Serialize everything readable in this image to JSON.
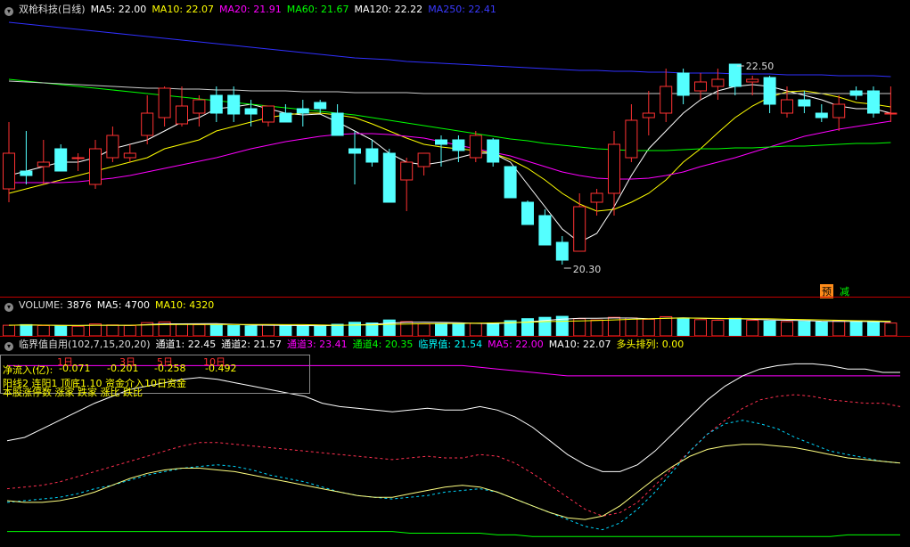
{
  "header": {
    "name": "双枪科技(日线)",
    "ma_items": [
      {
        "text": "MA5: 22.00",
        "color": "#ffffff"
      },
      {
        "text": "MA10: 22.07",
        "color": "#ffff00"
      },
      {
        "text": "MA20: 21.91",
        "color": "#ff00ff"
      },
      {
        "text": "MA60: 21.67",
        "color": "#00ff00"
      },
      {
        "text": "MA120: 22.22",
        "color": "#ffffff"
      },
      {
        "text": "MA250: 22.41",
        "color": "#3a3aff"
      }
    ]
  },
  "badges": {
    "a": "预",
    "b": "减"
  },
  "volume_header": {
    "label": "VOLUME:",
    "items": [
      {
        "text": "3876",
        "color": "#ffffff"
      },
      {
        "text": "MA5: 4700",
        "color": "#ffffff"
      },
      {
        "text": "MA10: 4320",
        "color": "#ffff00"
      }
    ]
  },
  "indicator_header": {
    "label": "临界值自用(102,7,15,20,20)",
    "items": [
      {
        "text": "通道1: 22.45",
        "color": "#ffffff"
      },
      {
        "text": "通道2: 21.57",
        "color": "#ffffff"
      },
      {
        "text": "通道3: 23.41",
        "color": "#ff00ff"
      },
      {
        "text": "通道4: 20.35",
        "color": "#00ff00"
      },
      {
        "text": "临界值: 21.54",
        "color": "#00ffff"
      },
      {
        "text": "MA5: 22.00",
        "color": "#ff00ff"
      },
      {
        "text": "MA10: 22.07",
        "color": "#ffffff"
      },
      {
        "text": "多头排列: 0.00",
        "color": "#ffff00"
      }
    ]
  },
  "info_box": {
    "row1": [
      "1日",
      "3日",
      "5日",
      "10日"
    ],
    "row2_label": "净流入(亿):",
    "row2": [
      "-0.071",
      "-0.201",
      "-0.258",
      "-0.492"
    ],
    "row3": "阳线2  连阳1  顶底1.10  资金介入10日资金",
    "row4": "本股涨停数  涨家  跌家  涨比  跌比"
  },
  "chart_data": {
    "type": "candlestick",
    "annotations": {
      "high": "22.50",
      "low": "20.30"
    },
    "candles": [
      {
        "o": 21.15,
        "h": 21.9,
        "l": 21.0,
        "c": 21.55
      },
      {
        "o": 21.35,
        "h": 21.8,
        "l": 21.2,
        "c": 21.3
      },
      {
        "o": 21.4,
        "h": 21.7,
        "l": 21.2,
        "c": 21.45
      },
      {
        "o": 21.6,
        "h": 21.65,
        "l": 21.35,
        "c": 21.35
      },
      {
        "o": 21.5,
        "h": 21.55,
        "l": 21.35,
        "c": 21.5
      },
      {
        "o": 21.2,
        "h": 21.7,
        "l": 21.15,
        "c": 21.6
      },
      {
        "o": 21.5,
        "h": 21.85,
        "l": 21.45,
        "c": 21.75
      },
      {
        "o": 21.5,
        "h": 21.65,
        "l": 21.45,
        "c": 21.55
      },
      {
        "o": 21.75,
        "h": 22.2,
        "l": 21.65,
        "c": 22.0
      },
      {
        "o": 21.95,
        "h": 22.3,
        "l": 21.85,
        "c": 22.28
      },
      {
        "o": 21.88,
        "h": 22.3,
        "l": 21.85,
        "c": 22.08
      },
      {
        "o": 22.0,
        "h": 22.2,
        "l": 21.85,
        "c": 22.15
      },
      {
        "o": 22.2,
        "h": 22.3,
        "l": 21.9,
        "c": 22.0
      },
      {
        "o": 22.2,
        "h": 22.3,
        "l": 21.9,
        "c": 21.99
      },
      {
        "o": 22.05,
        "h": 22.15,
        "l": 21.85,
        "c": 21.99
      },
      {
        "o": 21.9,
        "h": 22.05,
        "l": 21.85,
        "c": 22.08
      },
      {
        "o": 22.0,
        "h": 22.1,
        "l": 21.9,
        "c": 21.9
      },
      {
        "o": 22.05,
        "h": 22.15,
        "l": 21.85,
        "c": 22.0
      },
      {
        "o": 22.12,
        "h": 22.15,
        "l": 22.0,
        "c": 22.05
      },
      {
        "o": 22.0,
        "h": 22.1,
        "l": 21.8,
        "c": 21.75
      },
      {
        "o": 21.6,
        "h": 21.8,
        "l": 21.2,
        "c": 21.55
      },
      {
        "o": 21.6,
        "h": 21.7,
        "l": 21.4,
        "c": 21.45
      },
      {
        "o": 21.55,
        "h": 21.6,
        "l": 21.0,
        "c": 21.0
      },
      {
        "o": 21.25,
        "h": 21.5,
        "l": 20.9,
        "c": 21.45
      },
      {
        "o": 21.4,
        "h": 21.55,
        "l": 21.3,
        "c": 21.55
      },
      {
        "o": 21.7,
        "h": 21.75,
        "l": 21.4,
        "c": 21.65
      },
      {
        "o": 21.7,
        "h": 21.75,
        "l": 21.45,
        "c": 21.58
      },
      {
        "o": 21.5,
        "h": 21.8,
        "l": 21.45,
        "c": 21.75
      },
      {
        "o": 21.7,
        "h": 21.72,
        "l": 21.4,
        "c": 21.45
      },
      {
        "o": 21.4,
        "h": 21.4,
        "l": 21.05,
        "c": 21.05
      },
      {
        "o": 21.0,
        "h": 21.02,
        "l": 20.75,
        "c": 20.75
      },
      {
        "o": 20.85,
        "h": 20.92,
        "l": 20.52,
        "c": 20.52
      },
      {
        "o": 20.55,
        "h": 20.62,
        "l": 20.3,
        "c": 20.35
      },
      {
        "o": 20.45,
        "h": 21.1,
        "l": 20.45,
        "c": 20.95
      },
      {
        "o": 21.0,
        "h": 21.15,
        "l": 20.85,
        "c": 21.1
      },
      {
        "o": 21.1,
        "h": 21.8,
        "l": 20.85,
        "c": 21.65
      },
      {
        "o": 21.5,
        "h": 22.1,
        "l": 21.45,
        "c": 21.92
      },
      {
        "o": 21.95,
        "h": 22.25,
        "l": 21.75,
        "c": 22.0
      },
      {
        "o": 22.0,
        "h": 22.5,
        "l": 21.9,
        "c": 22.3
      },
      {
        "o": 22.45,
        "h": 22.5,
        "l": 22.1,
        "c": 22.2
      },
      {
        "o": 22.25,
        "h": 22.45,
        "l": 22.15,
        "c": 22.35
      },
      {
        "o": 22.3,
        "h": 22.5,
        "l": 22.15,
        "c": 22.38
      },
      {
        "o": 22.55,
        "h": 22.55,
        "l": 22.2,
        "c": 22.3
      },
      {
        "o": 22.35,
        "h": 22.42,
        "l": 22.2,
        "c": 22.38
      },
      {
        "o": 22.4,
        "h": 22.42,
        "l": 22.0,
        "c": 22.1
      },
      {
        "o": 22.0,
        "h": 22.3,
        "l": 21.95,
        "c": 22.15
      },
      {
        "o": 22.15,
        "h": 22.25,
        "l": 22.0,
        "c": 22.08
      },
      {
        "o": 22.0,
        "h": 22.1,
        "l": 21.9,
        "c": 21.95
      },
      {
        "o": 21.95,
        "h": 22.2,
        "l": 21.8,
        "c": 22.1
      },
      {
        "o": 22.25,
        "h": 22.3,
        "l": 22.15,
        "c": 22.2
      },
      {
        "o": 22.25,
        "h": 22.3,
        "l": 21.95,
        "c": 22.0
      },
      {
        "o": 22.0,
        "h": 22.3,
        "l": 21.9,
        "c": 22.0
      }
    ],
    "ma_lines": [
      {
        "name": "MA5",
        "color": "#ffffff",
        "values": [
          21.3,
          21.35,
          21.4,
          21.45,
          21.45,
          21.5,
          21.6,
          21.65,
          21.7,
          21.8,
          21.9,
          21.95,
          22.05,
          22.07,
          22.1,
          22.05,
          22.0,
          21.98,
          21.99,
          21.9,
          21.8,
          21.7,
          21.55,
          21.45,
          21.42,
          21.45,
          21.5,
          21.55,
          21.55,
          21.45,
          21.2,
          20.95,
          20.7,
          20.55,
          20.65,
          20.95,
          21.3,
          21.6,
          21.8,
          22.0,
          22.15,
          22.25,
          22.3,
          22.32,
          22.3,
          22.25,
          22.2,
          22.15,
          22.08,
          22.05,
          22.05,
          22.0
        ]
      },
      {
        "name": "MA10",
        "color": "#ffff00",
        "values": [
          21.1,
          21.15,
          21.2,
          21.25,
          21.3,
          21.35,
          21.4,
          21.45,
          21.5,
          21.6,
          21.65,
          21.7,
          21.8,
          21.85,
          21.9,
          21.95,
          21.98,
          22.0,
          22.0,
          21.98,
          21.95,
          21.88,
          21.8,
          21.72,
          21.65,
          21.62,
          21.6,
          21.58,
          21.55,
          21.48,
          21.38,
          21.25,
          21.1,
          20.98,
          20.9,
          20.92,
          21.0,
          21.1,
          21.25,
          21.45,
          21.6,
          21.78,
          21.95,
          22.08,
          22.18,
          22.24,
          22.25,
          22.22,
          22.18,
          22.12,
          22.1,
          22.07
        ]
      },
      {
        "name": "MA20",
        "color": "#ff00ff",
        "values": [
          21.22,
          21.22,
          21.22,
          21.22,
          21.23,
          21.25,
          21.27,
          21.3,
          21.34,
          21.38,
          21.42,
          21.46,
          21.5,
          21.55,
          21.6,
          21.64,
          21.68,
          21.71,
          21.74,
          21.76,
          21.77,
          21.77,
          21.76,
          21.74,
          21.72,
          21.68,
          21.64,
          21.6,
          21.56,
          21.52,
          21.46,
          21.4,
          21.34,
          21.3,
          21.27,
          21.26,
          21.26,
          21.27,
          21.3,
          21.34,
          21.4,
          21.45,
          21.5,
          21.56,
          21.62,
          21.68,
          21.74,
          21.78,
          21.82,
          21.85,
          21.88,
          21.91
        ]
      },
      {
        "name": "MA60",
        "color": "#00ff00",
        "values": [
          22.38,
          22.36,
          22.34,
          22.32,
          22.3,
          22.28,
          22.26,
          22.24,
          22.22,
          22.2,
          22.18,
          22.16,
          22.14,
          22.12,
          22.1,
          22.08,
          22.06,
          22.04,
          22.02,
          22.0,
          21.98,
          21.95,
          21.92,
          21.89,
          21.86,
          21.83,
          21.8,
          21.77,
          21.74,
          21.71,
          21.69,
          21.66,
          21.64,
          21.62,
          21.6,
          21.59,
          21.58,
          21.58,
          21.58,
          21.59,
          21.6,
          21.6,
          21.61,
          21.61,
          21.62,
          21.63,
          21.63,
          21.64,
          21.65,
          21.66,
          21.66,
          21.67
        ]
      },
      {
        "name": "MA120",
        "color": "#cccccc",
        "values": [
          22.36,
          22.35,
          22.34,
          22.33,
          22.32,
          22.31,
          22.3,
          22.29,
          22.28,
          22.28,
          22.27,
          22.27,
          22.26,
          22.26,
          22.25,
          22.25,
          22.25,
          22.24,
          22.24,
          22.24,
          22.23,
          22.23,
          22.23,
          22.23,
          22.22,
          22.22,
          22.22,
          22.22,
          22.22,
          22.22,
          22.22,
          22.22,
          22.22,
          22.22,
          22.22,
          22.22,
          22.22,
          22.22,
          22.22,
          22.22,
          22.22,
          22.22,
          22.22,
          22.22,
          22.22,
          22.22,
          22.22,
          22.22,
          22.22,
          22.22,
          22.22,
          22.22
        ]
      },
      {
        "name": "MA250",
        "color": "#3030ff",
        "values": [
          23.02,
          23.0,
          22.98,
          22.96,
          22.94,
          22.92,
          22.9,
          22.88,
          22.86,
          22.84,
          22.82,
          22.8,
          22.78,
          22.76,
          22.74,
          22.72,
          22.7,
          22.68,
          22.66,
          22.64,
          22.62,
          22.61,
          22.6,
          22.58,
          22.57,
          22.56,
          22.55,
          22.54,
          22.53,
          22.52,
          22.51,
          22.5,
          22.49,
          22.48,
          22.48,
          22.47,
          22.47,
          22.46,
          22.46,
          22.45,
          22.45,
          22.45,
          22.44,
          22.44,
          22.44,
          22.43,
          22.43,
          22.43,
          22.42,
          22.42,
          22.42,
          22.41
        ]
      }
    ],
    "volume": [
      3200,
      3400,
      3100,
      3000,
      2900,
      3600,
      3300,
      3100,
      4000,
      4200,
      3600,
      3400,
      3200,
      3100,
      3000,
      3300,
      3100,
      3000,
      2900,
      3500,
      4100,
      3900,
      4800,
      4300,
      3600,
      3700,
      3500,
      3800,
      3900,
      4600,
      5200,
      5600,
      5900,
      5200,
      4800,
      5600,
      5400,
      5000,
      5800,
      5400,
      4900,
      4700,
      5300,
      4700,
      4500,
      4300,
      4400,
      4200,
      4600,
      4300,
      4100,
      3876
    ],
    "indicator": {
      "ch1": [
        0.48,
        0.5,
        0.55,
        0.6,
        0.65,
        0.7,
        0.74,
        0.78,
        0.8,
        0.82,
        0.84,
        0.85,
        0.84,
        0.82,
        0.8,
        0.78,
        0.76,
        0.74,
        0.7,
        0.68,
        0.67,
        0.66,
        0.65,
        0.66,
        0.67,
        0.66,
        0.66,
        0.68,
        0.66,
        0.62,
        0.56,
        0.48,
        0.4,
        0.34,
        0.3,
        0.3,
        0.34,
        0.42,
        0.52,
        0.62,
        0.72,
        0.8,
        0.86,
        0.9,
        0.92,
        0.93,
        0.93,
        0.92,
        0.9,
        0.9,
        0.88,
        0.88
      ],
      "ch2": [
        0.2,
        0.21,
        0.22,
        0.24,
        0.27,
        0.3,
        0.33,
        0.36,
        0.39,
        0.42,
        0.45,
        0.47,
        0.47,
        0.46,
        0.45,
        0.44,
        0.43,
        0.42,
        0.41,
        0.4,
        0.39,
        0.38,
        0.37,
        0.38,
        0.39,
        0.38,
        0.38,
        0.4,
        0.39,
        0.35,
        0.29,
        0.22,
        0.15,
        0.08,
        0.04,
        0.06,
        0.12,
        0.22,
        0.32,
        0.42,
        0.52,
        0.6,
        0.67,
        0.72,
        0.74,
        0.75,
        0.74,
        0.72,
        0.71,
        0.7,
        0.7,
        0.68
      ],
      "ch3": [
        0.13,
        0.12,
        0.12,
        0.13,
        0.15,
        0.18,
        0.22,
        0.26,
        0.29,
        0.31,
        0.32,
        0.32,
        0.31,
        0.3,
        0.28,
        0.26,
        0.24,
        0.22,
        0.2,
        0.18,
        0.16,
        0.15,
        0.15,
        0.17,
        0.19,
        0.21,
        0.22,
        0.21,
        0.18,
        0.14,
        0.1,
        0.06,
        0.03,
        0.02,
        0.04,
        0.1,
        0.18,
        0.26,
        0.33,
        0.39,
        0.43,
        0.45,
        0.46,
        0.46,
        0.45,
        0.44,
        0.42,
        0.4,
        0.38,
        0.37,
        0.36,
        0.35
      ],
      "ch4": [
        0.12,
        0.13,
        0.14,
        0.15,
        0.17,
        0.2,
        0.22,
        0.25,
        0.28,
        0.3,
        0.32,
        0.33,
        0.34,
        0.33,
        0.31,
        0.28,
        0.26,
        0.24,
        0.21,
        0.18,
        0.16,
        0.15,
        0.14,
        0.15,
        0.16,
        0.18,
        0.19,
        0.2,
        0.18,
        0.14,
        0.1,
        0.06,
        0.02,
        -0.02,
        -0.04,
        0.0,
        0.08,
        0.18,
        0.3,
        0.42,
        0.52,
        0.58,
        0.6,
        0.58,
        0.55,
        0.5,
        0.46,
        0.42,
        0.4,
        0.38,
        0.36,
        0.35
      ],
      "ma5": [
        0.92,
        0.92,
        0.92,
        0.92,
        0.92,
        0.92,
        0.92,
        0.92,
        0.92,
        0.92,
        0.92,
        0.92,
        0.92,
        0.92,
        0.92,
        0.92,
        0.92,
        0.92,
        0.92,
        0.92,
        0.92,
        0.92,
        0.92,
        0.92,
        0.92,
        0.92,
        0.92,
        0.91,
        0.9,
        0.89,
        0.88,
        0.87,
        0.86,
        0.86,
        0.86,
        0.86,
        0.86,
        0.86,
        0.86,
        0.86,
        0.86,
        0.86,
        0.86,
        0.86,
        0.86,
        0.86,
        0.86,
        0.86,
        0.86,
        0.86,
        0.86,
        0.86
      ],
      "ch5": [
        -0.05,
        -0.05,
        -0.05,
        -0.05,
        -0.05,
        -0.05,
        -0.05,
        -0.05,
        -0.05,
        -0.05,
        -0.05,
        -0.05,
        -0.05,
        -0.05,
        -0.05,
        -0.05,
        -0.05,
        -0.05,
        -0.05,
        -0.05,
        -0.05,
        -0.05,
        -0.05,
        -0.06,
        -0.06,
        -0.06,
        -0.06,
        -0.06,
        -0.07,
        -0.07,
        -0.08,
        -0.08,
        -0.08,
        -0.08,
        -0.08,
        -0.08,
        -0.08,
        -0.08,
        -0.08,
        -0.08,
        -0.08,
        -0.08,
        -0.08,
        -0.08,
        -0.08,
        -0.08,
        -0.08,
        -0.08,
        -0.07,
        -0.07,
        -0.07,
        -0.07
      ]
    }
  }
}
